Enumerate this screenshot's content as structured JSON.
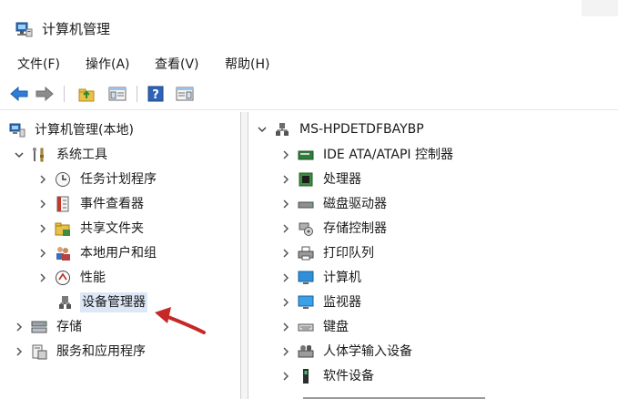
{
  "window": {
    "title": "计算机管理"
  },
  "menu": {
    "items": [
      "文件(F)",
      "操作(A)",
      "查看(V)",
      "帮助(H)"
    ]
  },
  "left_tree": {
    "root": "计算机管理(本地)",
    "system_tools": "系统工具",
    "children": [
      "任务计划程序",
      "事件查看器",
      "共享文件夹",
      "本地用户和组",
      "性能",
      "设备管理器"
    ],
    "storage": "存储",
    "services": "服务和应用程序"
  },
  "right_tree": {
    "computer": "MS-HPDETDFBAYBP",
    "devices": [
      "IDE ATA/ATAPI 控制器",
      "处理器",
      "磁盘驱动器",
      "存储控制器",
      "打印队列",
      "计算机",
      "监视器",
      "键盘",
      "人体学输入设备",
      "软件设备"
    ]
  }
}
